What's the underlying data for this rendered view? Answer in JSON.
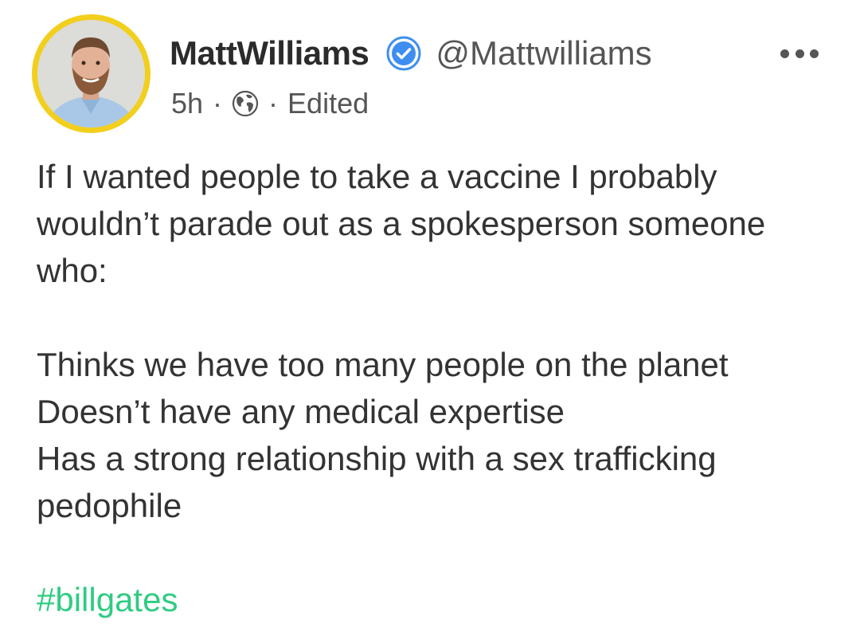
{
  "post": {
    "author": {
      "display_name": "MattWilliams",
      "handle": "@Mattwilliams",
      "verified": true,
      "avatar_ring_color": "#f2cf1d"
    },
    "meta": {
      "time": "5h",
      "separator": "·",
      "visibility_icon": "globe-icon",
      "edited_label": "Edited"
    },
    "body": {
      "paragraph1": [
        "If I wanted people to take a vaccine I probably",
        "wouldn’t parade out as a spokesperson someone",
        "who:"
      ],
      "paragraph2": [
        "Thinks we have too many people on the planet",
        "Doesn’t have any medical expertise",
        "Has a strong relationship with a sex trafficking",
        "pedophile"
      ],
      "hashtag": "#billgates"
    },
    "menu_icon": "more-horizontal-icon"
  },
  "colors": {
    "verified_badge": "#3d8ef0",
    "hashtag": "#2fcc82",
    "text": "#333333",
    "secondary_text": "#555555"
  }
}
